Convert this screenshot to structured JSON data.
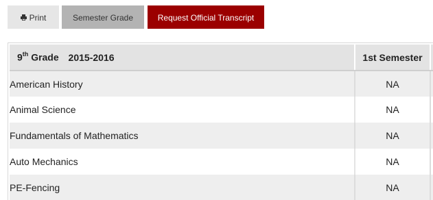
{
  "toolbar": {
    "print_label": "Print",
    "semester_grade_label": "Semester Grade",
    "request_transcript_label": "Request Official Transcript",
    "print_icon": "printer-icon",
    "accent_color": "#9b0000"
  },
  "table": {
    "grade_number": "9",
    "grade_suffix": "th",
    "grade_word": "Grade",
    "year": "2015-2016",
    "semester_header": "1st Semester",
    "rows": [
      {
        "course": "American History",
        "grade": "NA"
      },
      {
        "course": "Animal Science",
        "grade": "NA"
      },
      {
        "course": "Fundamentals of Mathematics",
        "grade": "NA"
      },
      {
        "course": "Auto Mechanics",
        "grade": "NA"
      },
      {
        "course": "PE-Fencing",
        "grade": "NA"
      }
    ]
  }
}
